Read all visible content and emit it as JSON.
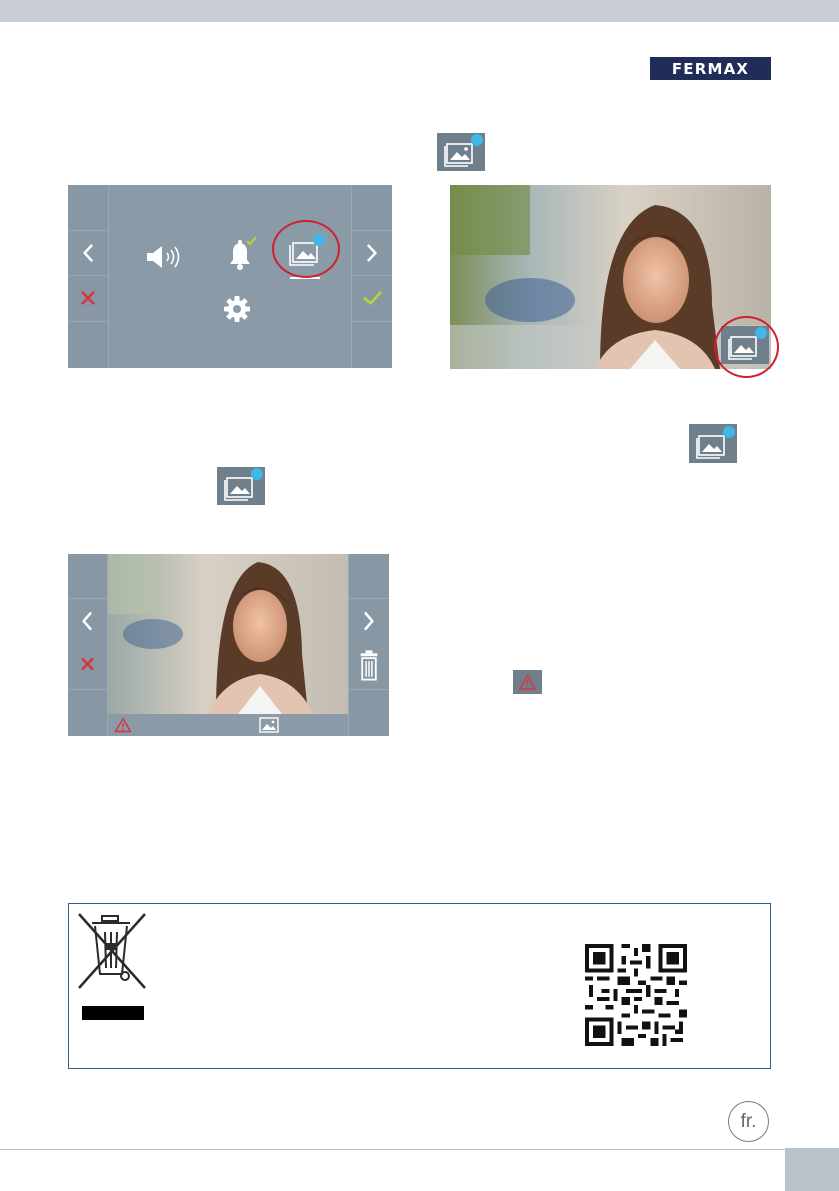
{
  "brand": {
    "name": "FERMAX"
  },
  "language_badge": {
    "label": "fr."
  },
  "colors": {
    "button_gray": "#707f8c",
    "screen_gray": "#8797a3",
    "cancel_red": "#d9353f",
    "confirm_green": "#b4d438",
    "notification_dot": "#3fb7e8",
    "highlight_ring": "#d11f2c",
    "box_border": "#2f5e8a"
  },
  "menu_screen": {
    "left_buttons": [
      "blank",
      "chevron-left-icon",
      "close-icon",
      "blank"
    ],
    "right_buttons": [
      "blank",
      "chevron-right-icon",
      "check-icon",
      "blank"
    ],
    "items": [
      "speaker-volume-icon",
      "bell-check-icon",
      "image-gallery-icon",
      "gear-icon"
    ],
    "selected_item": "image-gallery-icon"
  },
  "gallery_screen": {
    "left_buttons": [
      "blank",
      "chevron-left-icon",
      "close-icon",
      "blank"
    ],
    "right_buttons": [
      "blank",
      "chevron-right-icon",
      "trash-icon",
      "blank"
    ],
    "status_icons": [
      "warning-icon",
      "image-icon"
    ]
  },
  "inline_icons": [
    "image-gallery-icon",
    "image-gallery-icon",
    "image-gallery-icon",
    "warning-icon"
  ],
  "recycling": {
    "icons": [
      "crossed-bin-icon",
      "qr-code-icon"
    ]
  }
}
